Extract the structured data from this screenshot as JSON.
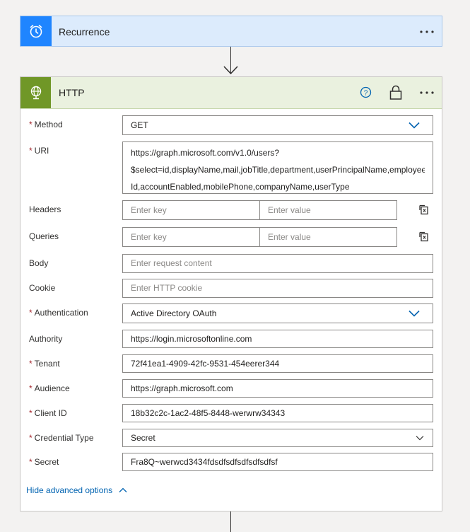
{
  "recurrence": {
    "title": "Recurrence",
    "icon": "alarm-clock-icon"
  },
  "http": {
    "title": "HTTP",
    "icon": "globe-icon",
    "fields": {
      "method": {
        "label": "Method",
        "required": true,
        "value": "GET"
      },
      "uri": {
        "label": "URI",
        "required": true,
        "lines": [
          "https://graph.microsoft.com/v1.0/users?",
          "$select=id,displayName,mail,jobTitle,department,userPrincipalName,employee",
          "Id,accountEnabled,mobilePhone,companyName,userType"
        ]
      },
      "headers": {
        "label": "Headers",
        "key_placeholder": "Enter key",
        "value_placeholder": "Enter value"
      },
      "queries": {
        "label": "Queries",
        "key_placeholder": "Enter key",
        "value_placeholder": "Enter value"
      },
      "body": {
        "label": "Body",
        "placeholder": "Enter request content"
      },
      "cookie": {
        "label": "Cookie",
        "placeholder": "Enter HTTP cookie"
      },
      "authentication": {
        "label": "Authentication",
        "required": true,
        "value": "Active Directory OAuth"
      },
      "authority": {
        "label": "Authority",
        "value": "https://login.microsoftonline.com"
      },
      "tenant": {
        "label": "Tenant",
        "required": true,
        "value": "72f41ea1-4909-42fc-9531-454eerer344"
      },
      "audience": {
        "label": "Audience",
        "required": true,
        "value": "https://graph.microsoft.com"
      },
      "client_id": {
        "label": "Client ID",
        "required": true,
        "value": "18b32c2c-1ac2-48f5-8448-werwrw34343"
      },
      "credential_type": {
        "label": "Credential Type",
        "required": true,
        "value": "Secret"
      },
      "secret": {
        "label": "Secret",
        "required": true,
        "value": "Fra8Q~werwcd3434fdsdfsdfsdfsdfsdfsf"
      }
    },
    "advanced_link": "Hide advanced options"
  },
  "required_marker": "*",
  "colors": {
    "recurrence_accent": "#1f85ff",
    "http_accent": "#709727",
    "link": "#0063b1",
    "required": "#a4262c"
  }
}
